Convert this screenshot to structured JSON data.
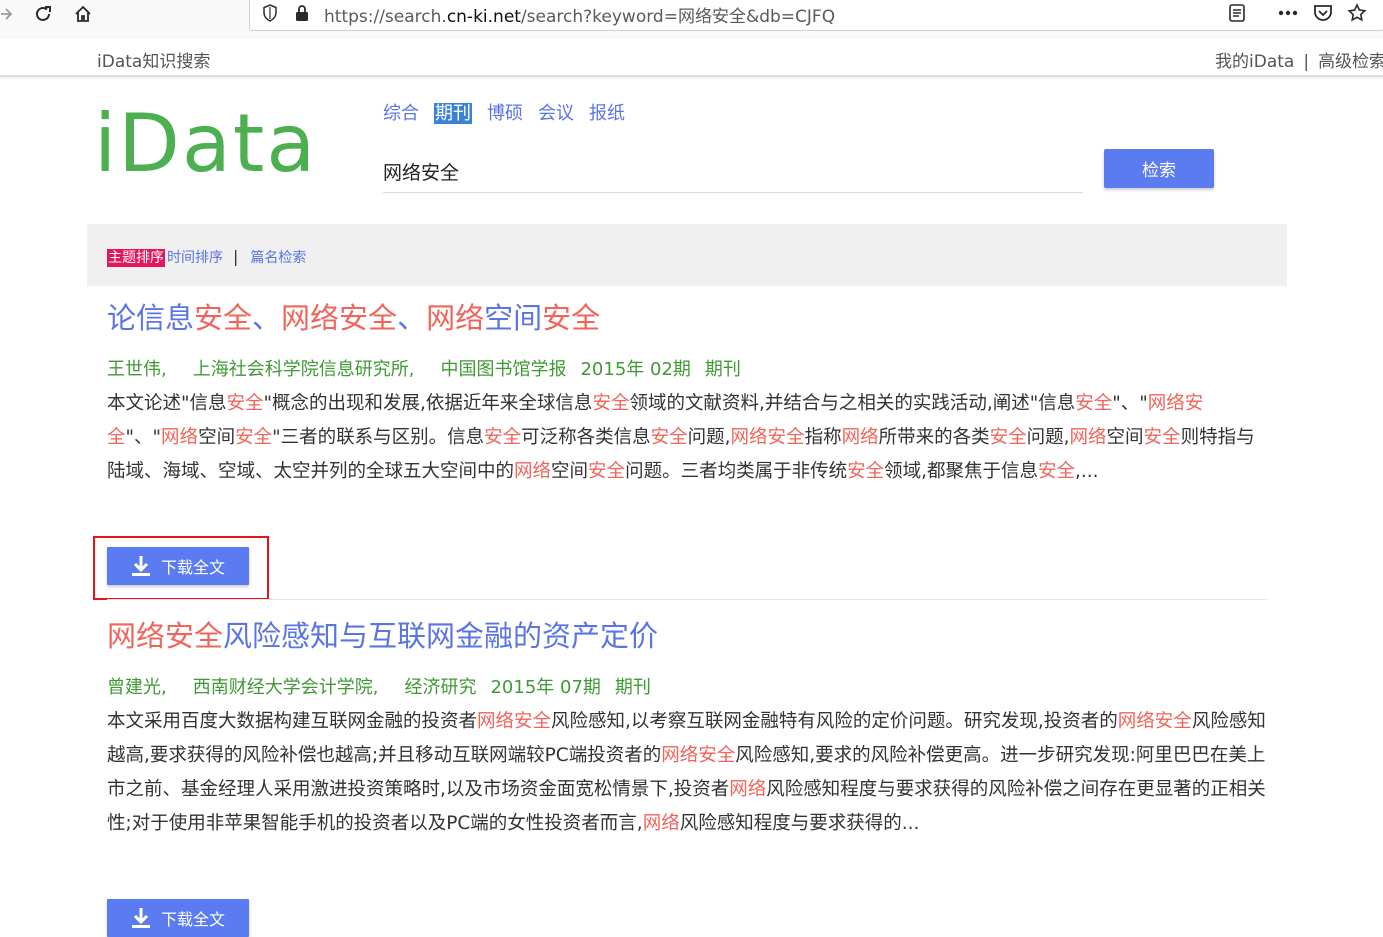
{
  "browser": {
    "url_prefix": "https://search.",
    "url_domain": "cn-ki.net",
    "url_rest": "/search?keyword=网络安全&db=CJFQ"
  },
  "site": {
    "name": "iData知识搜索",
    "links": [
      "我的iData",
      "高级检索"
    ],
    "link_separator": "|"
  },
  "logo": "iData",
  "tabs": [
    "综合",
    "期刊",
    "博硕",
    "会议",
    "报纸"
  ],
  "active_tab": "期刊",
  "search": {
    "value": "网络安全",
    "button_label": "检索"
  },
  "sortbar": {
    "active": "主题排序",
    "time": "时间排序",
    "separator": "|",
    "title_search": "篇名检索"
  },
  "results": [
    {
      "title_parts": [
        {
          "t": "论信息",
          "hl": false
        },
        {
          "t": "安全",
          "hl": true
        },
        {
          "t": "、",
          "hl": false
        },
        {
          "t": "网络安全",
          "hl": true
        },
        {
          "t": "、",
          "hl": false
        },
        {
          "t": "网络",
          "hl": true
        },
        {
          "t": "空间",
          "hl": false
        },
        {
          "t": "安全",
          "hl": true
        }
      ],
      "meta": [
        "王世伟,",
        "上海社会科学院信息研究所,",
        "中国图书馆学报",
        "2015年 02期",
        "期刊"
      ],
      "abstract_parts": [
        {
          "t": "本文论述\"信息",
          "hl": false
        },
        {
          "t": "安全",
          "hl": true
        },
        {
          "t": "\"概念的出现和发展,依据近年来全球信息",
          "hl": false
        },
        {
          "t": "安全",
          "hl": true
        },
        {
          "t": "领域的文献资料,并结合与之相关的实践活动,阐述\"信息",
          "hl": false
        },
        {
          "t": "安全",
          "hl": true
        },
        {
          "t": "\"、\"",
          "hl": false
        },
        {
          "t": "网络安全",
          "hl": true
        },
        {
          "t": "\"、\"",
          "hl": false
        },
        {
          "t": "网络",
          "hl": true
        },
        {
          "t": "空间",
          "hl": false
        },
        {
          "t": "安全",
          "hl": true
        },
        {
          "t": "\"三者的联系与区别。信息",
          "hl": false
        },
        {
          "t": "安全",
          "hl": true
        },
        {
          "t": "可泛称各类信息",
          "hl": false
        },
        {
          "t": "安全",
          "hl": true
        },
        {
          "t": "问题,",
          "hl": false
        },
        {
          "t": "网络安全",
          "hl": true
        },
        {
          "t": "指称",
          "hl": false
        },
        {
          "t": "网络",
          "hl": true
        },
        {
          "t": "所带来的各类",
          "hl": false
        },
        {
          "t": "安全",
          "hl": true
        },
        {
          "t": "问题,",
          "hl": false
        },
        {
          "t": "网络",
          "hl": true
        },
        {
          "t": "空间",
          "hl": false
        },
        {
          "t": "安全",
          "hl": true
        },
        {
          "t": "则特指与陆域、海域、空域、太空并列的全球五大空间中的",
          "hl": false
        },
        {
          "t": "网络",
          "hl": true
        },
        {
          "t": "空间",
          "hl": false
        },
        {
          "t": "安全",
          "hl": true
        },
        {
          "t": "问题。三者均类属于非传统",
          "hl": false
        },
        {
          "t": "安全",
          "hl": true
        },
        {
          "t": "领域,都聚焦于信息",
          "hl": false
        },
        {
          "t": "安全",
          "hl": true
        },
        {
          "t": ",...",
          "hl": false
        }
      ],
      "download_label": "下载全文"
    },
    {
      "title_parts": [
        {
          "t": "网络安全",
          "hl": true
        },
        {
          "t": "风险感知与互联网金融的资产定价",
          "hl": false
        }
      ],
      "meta": [
        "曾建光,",
        "西南财经大学会计学院,",
        "经济研究",
        "2015年 07期",
        "期刊"
      ],
      "abstract_parts": [
        {
          "t": "本文采用百度大数据构建互联网金融的投资者",
          "hl": false
        },
        {
          "t": "网络安全",
          "hl": true
        },
        {
          "t": "风险感知,以考察互联网金融特有风险的定价问题。研究发现,投资者的",
          "hl": false
        },
        {
          "t": "网络安全",
          "hl": true
        },
        {
          "t": "风险感知越高,要求获得的风险补偿也越高;并且移动互联网端较PC端投资者的",
          "hl": false
        },
        {
          "t": "网络安全",
          "hl": true
        },
        {
          "t": "风险感知,要求的风险补偿更高。进一步研究发现:阿里巴巴在美上市之前、基金经理人采用激进投资策略时,以及市场资金面宽松情景下,投资者",
          "hl": false
        },
        {
          "t": "网络",
          "hl": true
        },
        {
          "t": "风险感知程度与要求获得的风险补偿之间存在更显著的正相关性;对于使用非苹果智能手机的投资者以及PC端的女性投资者而言,",
          "hl": false
        },
        {
          "t": "网络",
          "hl": true
        },
        {
          "t": "风险感知程度与要求获得的...",
          "hl": false
        }
      ],
      "download_label": "下载全文"
    }
  ]
}
